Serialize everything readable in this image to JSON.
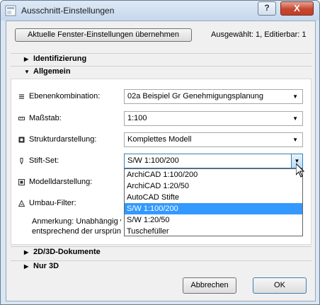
{
  "window": {
    "title": "Ausschnitt-Einstellungen",
    "help_label": "?",
    "close_label": "X"
  },
  "top": {
    "apply_button": "Aktuelle Fenster-Einstellungen übernehmen",
    "status": "Ausgewählt: 1, Editierbar: 1"
  },
  "sections": {
    "identifizierung": "Identifizierung",
    "allgemein": "Allgemein",
    "dokumente": "2D/3D-Dokumente",
    "nur3d": "Nur 3D"
  },
  "fields": {
    "ebenenkombination": {
      "label": "Ebenenkombination:",
      "value": "02a Beispiel Gr Genehmigungsplanung"
    },
    "massstab": {
      "label": "Maßstab:",
      "value": "1:100"
    },
    "struktur": {
      "label": "Strukturdarstellung:",
      "value": "Komplettes Modell"
    },
    "stiftset": {
      "label": "Stift-Set:",
      "value": "S/W 1:100/200"
    },
    "modell": {
      "label": "Modelldarstellung:"
    },
    "umbau": {
      "label": "Umbau-Filter:"
    }
  },
  "stiftset_options": [
    "ArchiCAD 1:100/200",
    "ArchiCAD 1:20/50",
    "AutoCAD Stifte",
    "S/W 1:100/200",
    "S/W 1:20/50",
    "Tuschefüller"
  ],
  "note": {
    "line1": "Anmerkung: Unabhängig von",
    "line2": "entsprechend der ursprünglic"
  },
  "footer": {
    "cancel": "Abbrechen",
    "ok": "OK"
  },
  "colors": {
    "selection": "#3399ff",
    "title_bar": "#c6d8ee",
    "close": "#c8462f"
  }
}
